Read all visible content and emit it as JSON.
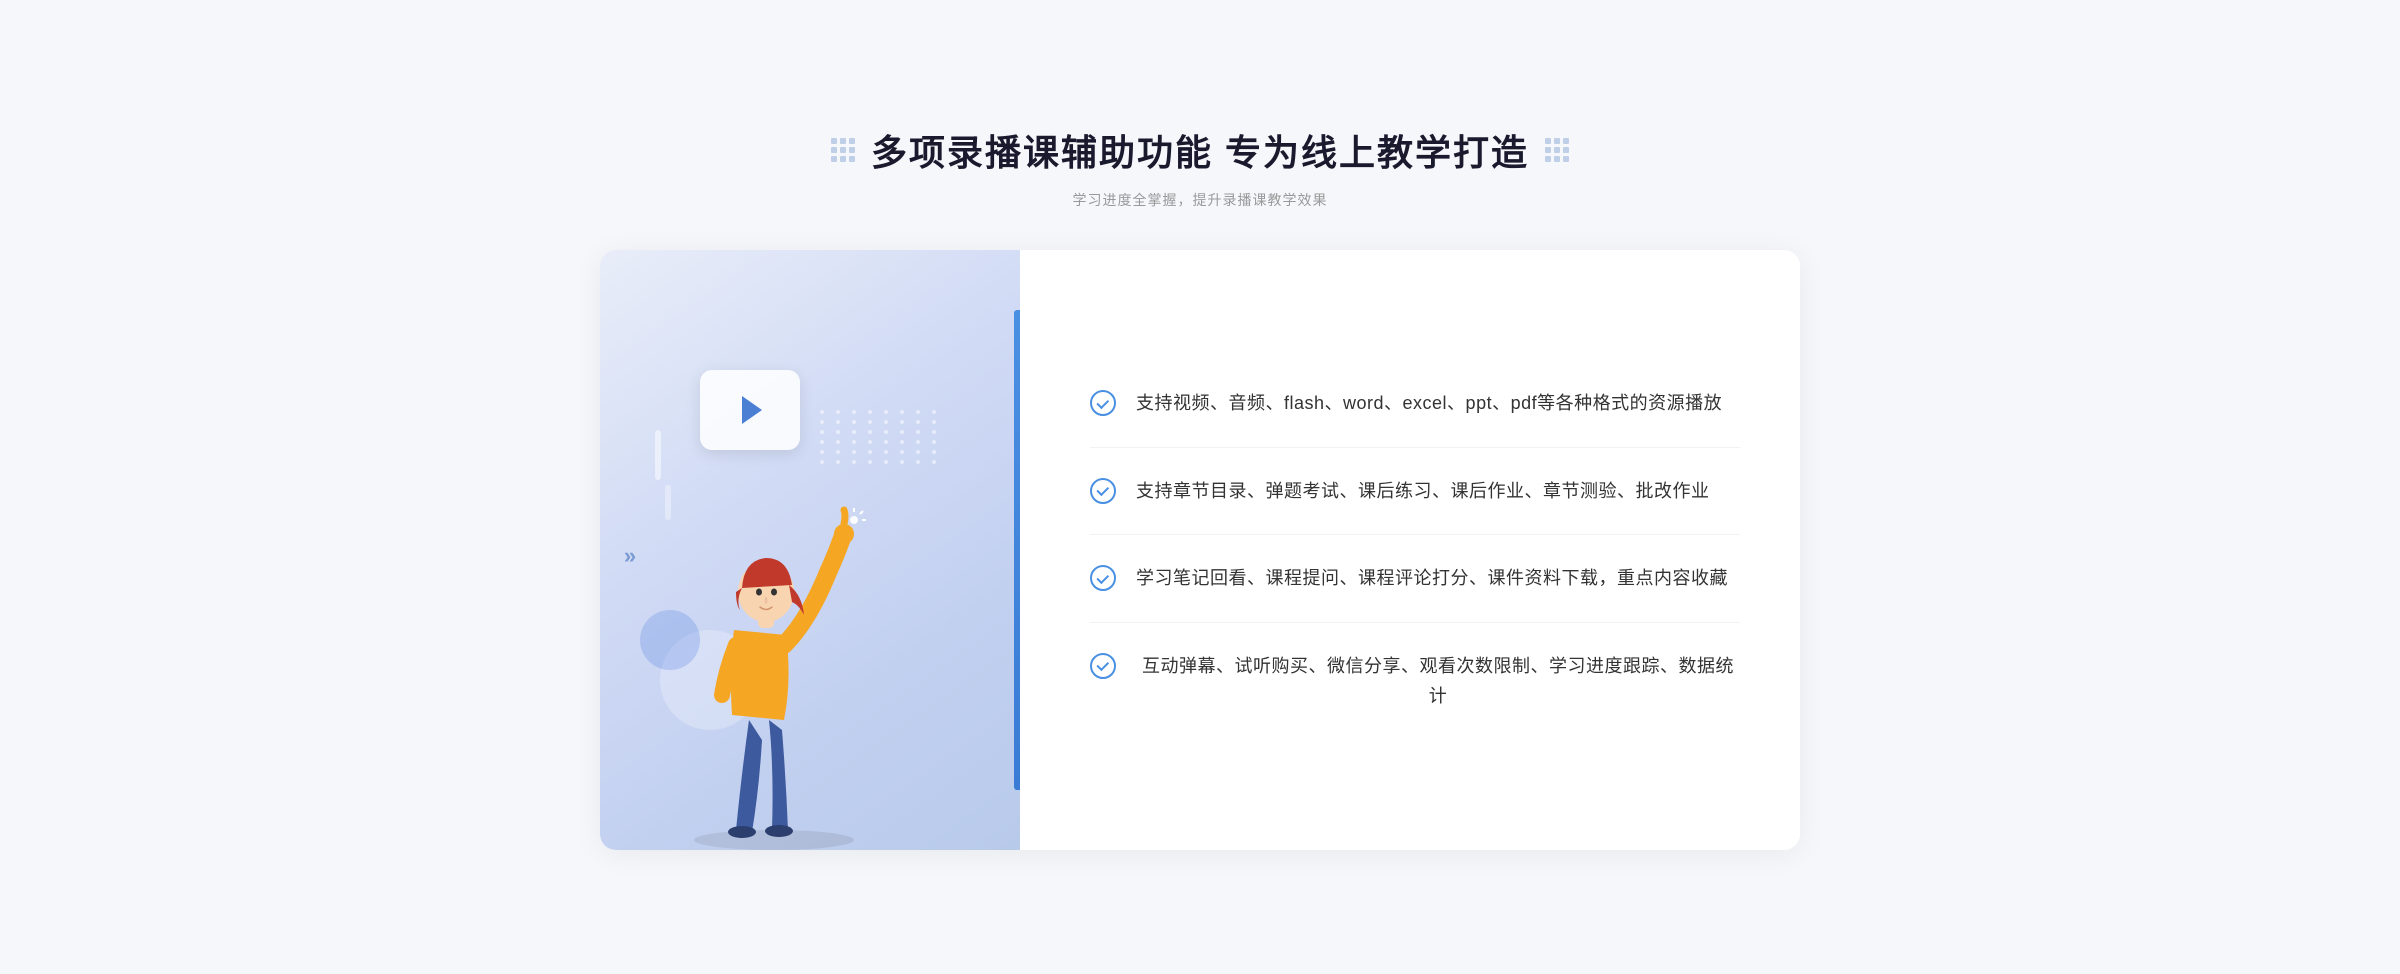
{
  "header": {
    "title": "多项录播课辅助功能 专为线上教学打造",
    "subtitle": "学习进度全掌握，提升录播课教学效果"
  },
  "features": [
    {
      "id": "feature-1",
      "text": "支持视频、音频、flash、word、excel、ppt、pdf等各种格式的资源播放"
    },
    {
      "id": "feature-2",
      "text": "支持章节目录、弹题考试、课后练习、课后作业、章节测验、批改作业"
    },
    {
      "id": "feature-3",
      "text": "学习笔记回看、课程提问、课程评论打分、课件资料下载，重点内容收藏"
    },
    {
      "id": "feature-4",
      "text": "互动弹幕、试听购买、微信分享、观看次数限制、学习进度跟踪、数据统计"
    }
  ],
  "icons": {
    "check": "✓",
    "arrow_right": "»",
    "play": "▶"
  },
  "colors": {
    "primary": "#4a90e2",
    "title": "#1a1a2e",
    "text": "#333333",
    "subtitle": "#999999",
    "border": "#f0f2f5",
    "illustration_bg": "#d5e0f5"
  }
}
